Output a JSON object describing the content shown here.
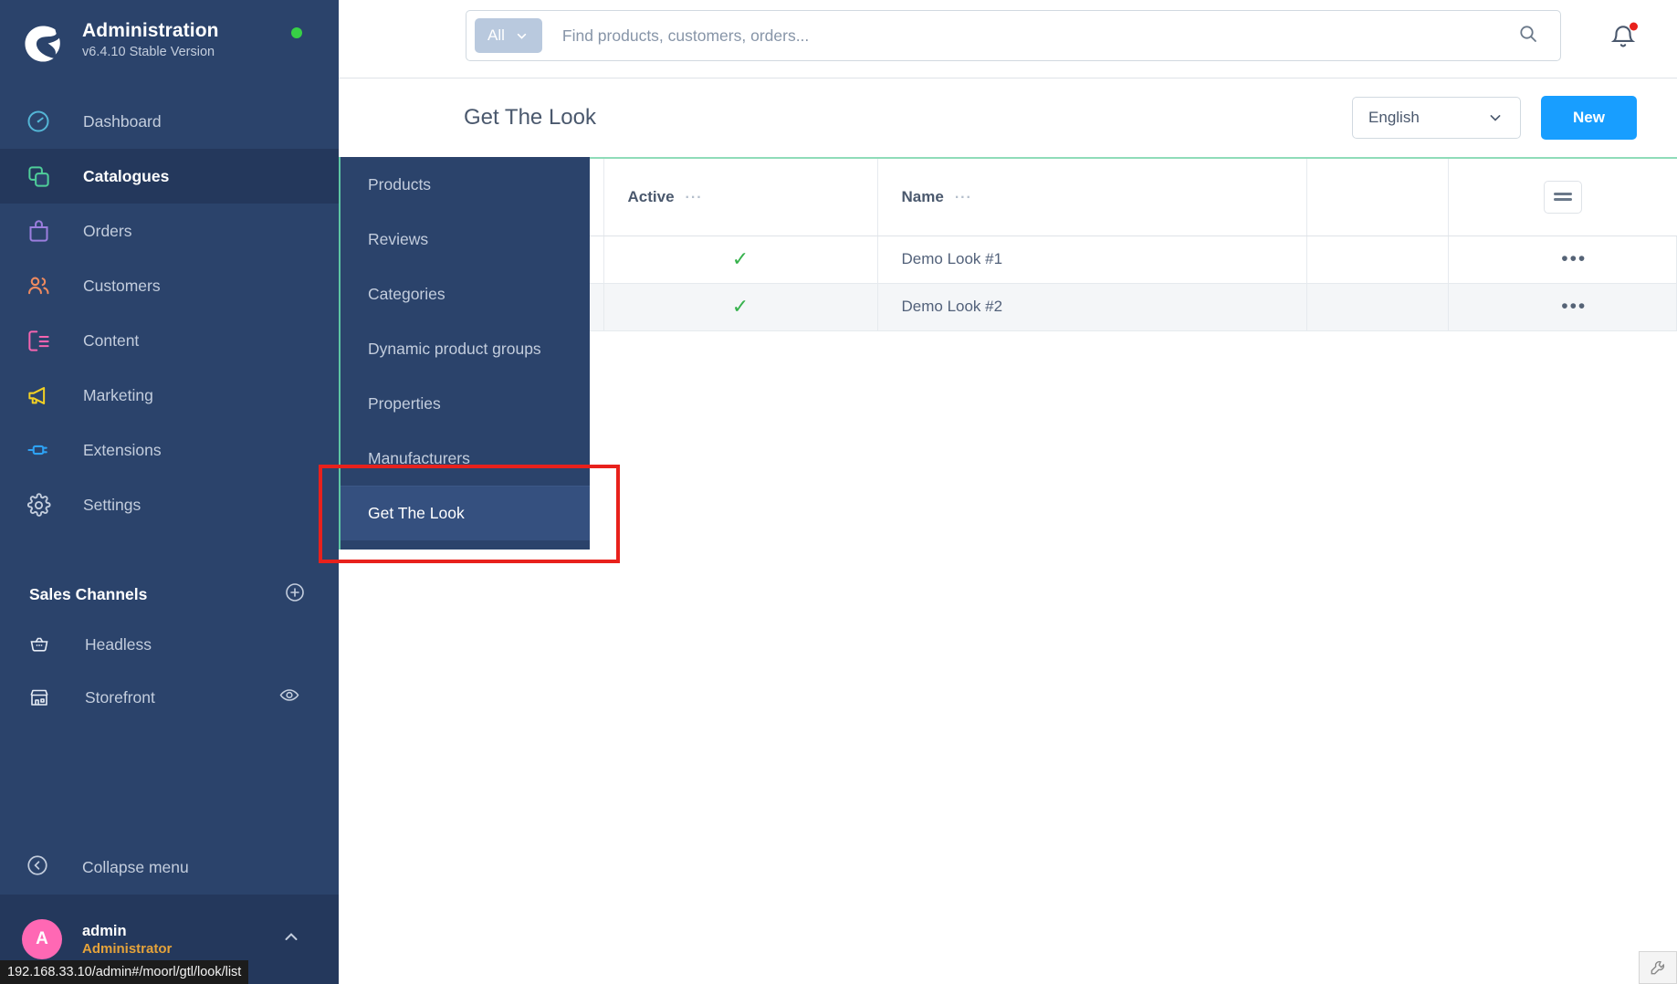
{
  "sidebar": {
    "app_title": "Administration",
    "version": "v6.4.10 Stable Version",
    "status_dot_color": "#37d046",
    "nav": [
      {
        "label": "Dashboard",
        "icon": "gauge-icon",
        "color": "#54b6d6"
      },
      {
        "label": "Catalogues",
        "icon": "layers-icon",
        "color": "#4fcf9a"
      },
      {
        "label": "Orders",
        "icon": "bag-icon",
        "color": "#9b7ede"
      },
      {
        "label": "Customers",
        "icon": "users-icon",
        "color": "#ee8a5f"
      },
      {
        "label": "Content",
        "icon": "content-icon",
        "color": "#f564b0"
      },
      {
        "label": "Marketing",
        "icon": "megaphone-icon",
        "color": "#f2d024"
      },
      {
        "label": "Extensions",
        "icon": "plug-icon",
        "color": "#2ea2f5"
      },
      {
        "label": "Settings",
        "icon": "gear-icon",
        "color": "#c3cddd"
      }
    ],
    "sales_channels_heading": "Sales Channels",
    "channels": [
      {
        "label": "Headless",
        "icon": "basket-icon"
      },
      {
        "label": "Storefront",
        "icon": "shop-icon"
      }
    ],
    "collapse_label": "Collapse menu",
    "user": {
      "initial": "A",
      "name": "admin",
      "role": "Administrator",
      "avatar_color": "#ff68b4",
      "role_color": "#e5a33a"
    }
  },
  "flyout": {
    "accent_color": "#5ec6a4",
    "items": [
      {
        "label": "Products",
        "selected": false
      },
      {
        "label": "Reviews",
        "selected": false
      },
      {
        "label": "Categories",
        "selected": false
      },
      {
        "label": "Dynamic product groups",
        "selected": false
      },
      {
        "label": "Properties",
        "selected": false
      },
      {
        "label": "Manufacturers",
        "selected": false
      },
      {
        "label": "Get The Look",
        "selected": true
      }
    ]
  },
  "annotation": {
    "color": "#e8211c"
  },
  "topbar": {
    "search_scope": "All",
    "search_placeholder": "Find products, customers, orders...",
    "search_value": "",
    "search_icon": "magnifier-icon",
    "notifications_icon": "bell-icon",
    "has_notification": true
  },
  "page_header": {
    "title": "Get The Look",
    "language": "English",
    "new_button": "New",
    "new_button_color": "#189eff"
  },
  "table": {
    "top_border_color": "#8fdcb9",
    "columns": [
      "",
      "Active",
      "Name",
      "",
      ""
    ],
    "sort_glyph": "···",
    "settings_icon": "grid-settings-icon",
    "row_menu_glyph": "•••",
    "check_glyph": "✓",
    "rows": [
      {
        "active": true,
        "name": "Demo Look #1"
      },
      {
        "active": true,
        "name": "Demo Look #2"
      }
    ]
  },
  "statusbar": {
    "url": "192.168.33.10/admin#/moorl/gtl/look/list"
  }
}
